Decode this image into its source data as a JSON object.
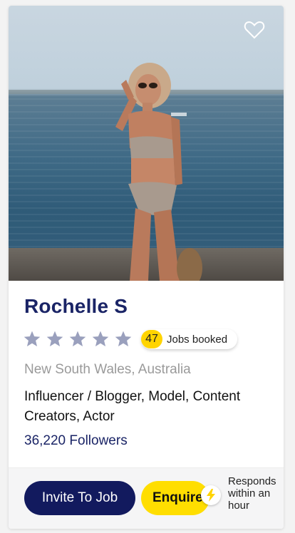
{
  "profile": {
    "name": "Rochelle S",
    "rating": 5,
    "jobs_booked_count": "47",
    "jobs_booked_label": "Jobs booked",
    "location": "New South Wales, Australia",
    "categories": "Influencer / Blogger, Model, Content Creators, Actor",
    "followers": "36,220 Followers"
  },
  "actions": {
    "invite_label": "Invite To Job",
    "enquire_label": "Enquire",
    "responds_text": "Responds within an hour"
  },
  "icons": {
    "favorite": "heart-outline-icon",
    "star": "star-icon",
    "lightning": "lightning-bolt-icon"
  },
  "colors": {
    "brand_navy": "#121a5e",
    "name_navy": "#1a2466",
    "accent_yellow": "#ffde00",
    "star_gray": "#9aa0bd"
  }
}
